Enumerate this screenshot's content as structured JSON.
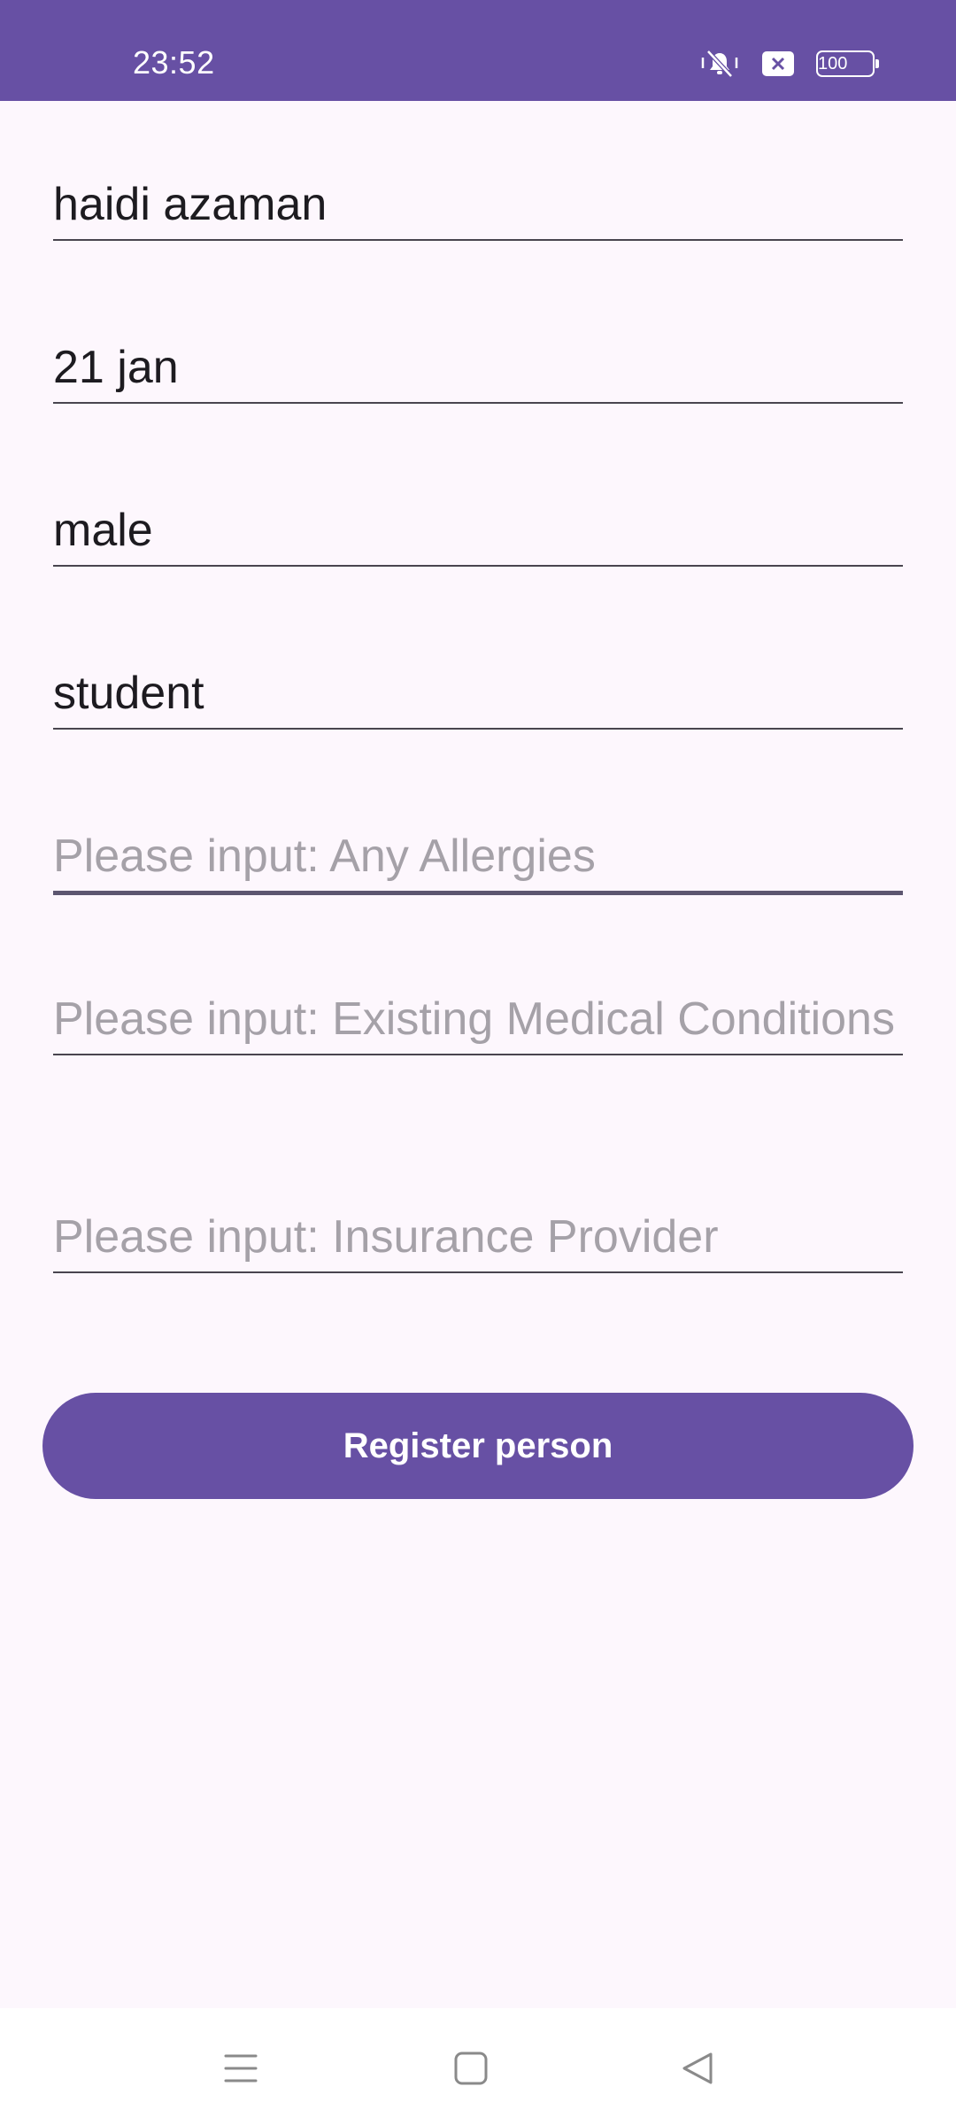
{
  "status_bar": {
    "time": "23:52",
    "battery_level": "100",
    "icons": [
      "vibrate-silent-icon",
      "notification-x-icon",
      "battery-icon"
    ],
    "background_color": "#6750a4"
  },
  "form": {
    "name_value": "haidi azaman",
    "dob_value": "21 jan",
    "gender_value": "male",
    "occupation_value": "student",
    "allergies_placeholder": "Please input: Any Allergies",
    "conditions_placeholder": "Please input: Existing Medical Conditions",
    "insurance_placeholder": "Please input: Insurance Provider",
    "register_label": "Register person"
  },
  "nav_bar": {
    "icons": [
      "menu-icon",
      "home-icon",
      "back-icon"
    ]
  },
  "colors": {
    "accent": "#6750a4",
    "background": "#fdf7fd",
    "placeholder_text": "#a5a1a8",
    "text": "#1d1b20"
  }
}
